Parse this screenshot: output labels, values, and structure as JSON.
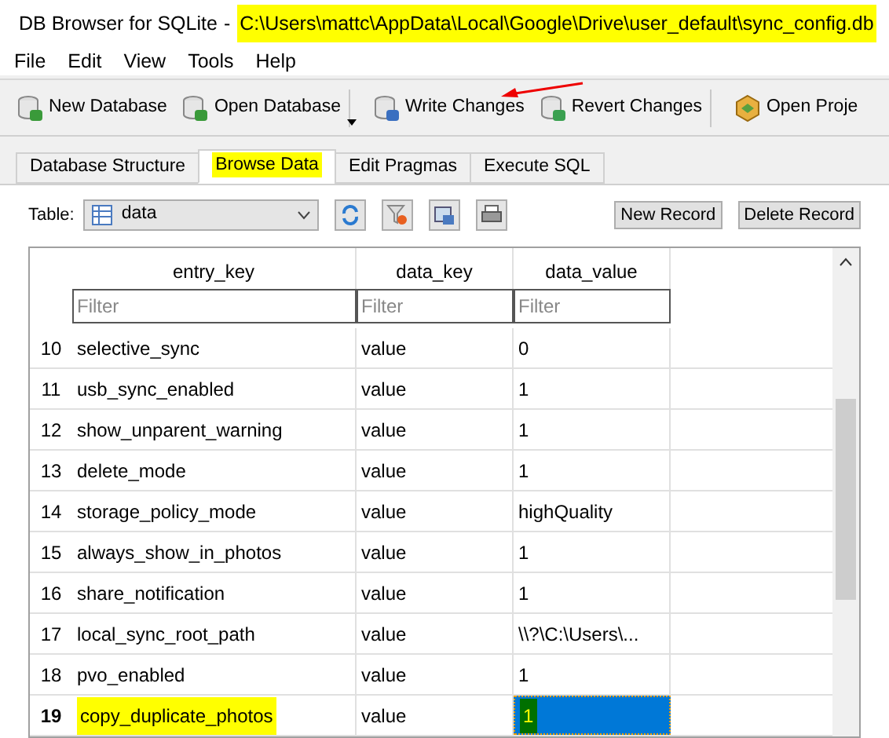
{
  "window": {
    "app_name": "DB Browser for SQLite",
    "separator": "-",
    "file_path": "C:\\Users\\mattc\\AppData\\Local\\Google\\Drive\\user_default\\sync_config.db",
    "path_highlighted": true
  },
  "menu": [
    "File",
    "Edit",
    "View",
    "Tools",
    "Help"
  ],
  "toolbar": [
    {
      "label": "New Database",
      "kind": "new"
    },
    {
      "label": "Open Database",
      "kind": "open"
    },
    {
      "label": "Write Changes",
      "kind": "write"
    },
    {
      "label": "Revert Changes",
      "kind": "revert"
    },
    {
      "label": "Open Proje",
      "kind": "project"
    }
  ],
  "tabs": [
    {
      "label": "Database Structure",
      "selected": false,
      "highlighted": false
    },
    {
      "label": "Browse Data",
      "selected": true,
      "highlighted": true
    },
    {
      "label": "Edit Pragmas",
      "selected": false,
      "highlighted": false
    },
    {
      "label": "Execute SQL",
      "selected": false,
      "highlighted": false
    }
  ],
  "table_bar": {
    "label": "Table:",
    "table": "data",
    "buttons": [
      "New Record",
      "Delete Record"
    ]
  },
  "grid": {
    "columns": [
      "entry_key",
      "data_key",
      "data_value"
    ],
    "filter_placeholders": [
      "Filter",
      "Filter",
      "Filter"
    ],
    "rows": [
      {
        "num": "10",
        "cells": [
          "selective_sync",
          "value",
          "0"
        ],
        "selected": false,
        "highlighted": false
      },
      {
        "num": "11",
        "cells": [
          "usb_sync_enabled",
          "value",
          "1"
        ],
        "selected": false,
        "highlighted": false
      },
      {
        "num": "12",
        "cells": [
          "show_unparent_warning",
          "value",
          "1"
        ],
        "selected": false,
        "highlighted": false
      },
      {
        "num": "13",
        "cells": [
          "delete_mode",
          "value",
          "1"
        ],
        "selected": false,
        "highlighted": false
      },
      {
        "num": "14",
        "cells": [
          "storage_policy_mode",
          "value",
          "highQuality"
        ],
        "selected": false,
        "highlighted": false
      },
      {
        "num": "15",
        "cells": [
          "always_show_in_photos",
          "value",
          "1"
        ],
        "selected": false,
        "highlighted": false
      },
      {
        "num": "16",
        "cells": [
          "share_notification",
          "value",
          "1"
        ],
        "selected": false,
        "highlighted": false
      },
      {
        "num": "17",
        "cells": [
          "local_sync_root_path",
          "value",
          "\\\\?\\C:\\Users\\..."
        ],
        "selected": false,
        "highlighted": false
      },
      {
        "num": "18",
        "cells": [
          "pvo_enabled",
          "value",
          "1"
        ],
        "selected": false,
        "highlighted": false
      },
      {
        "num": "19",
        "cells": [
          "copy_duplicate_photos",
          "value",
          "1"
        ],
        "selected": true,
        "highlighted": true
      }
    ]
  }
}
